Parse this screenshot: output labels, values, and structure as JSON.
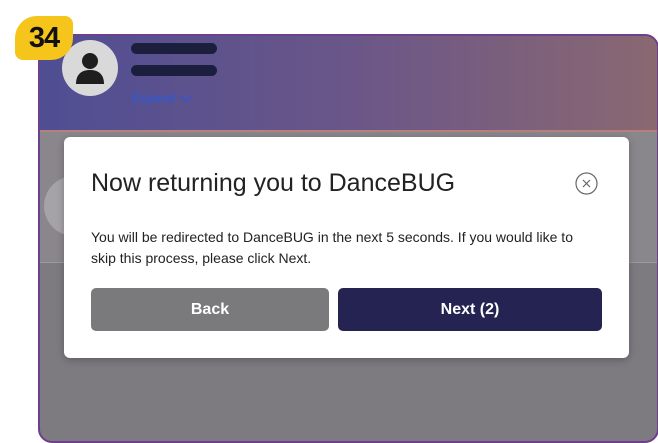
{
  "badge": {
    "number": "34"
  },
  "header": {
    "expand_label": "Expand"
  },
  "dialog": {
    "title": "Now returning you to DanceBUG",
    "message": "You will be redirected to DanceBUG in the next 5 seconds. If you would like to skip this process, please click Next.",
    "back_label": "Back",
    "next_label": "Next (2)"
  },
  "icons": {
    "avatar": "user-silhouette-icon",
    "expand": "chevron-down-icon",
    "close": "close-circle-icon"
  },
  "colors": {
    "badge": "#f5c51b",
    "frame_border": "#6e3f8c",
    "next_button": "#242351",
    "back_button": "#7a7a7c",
    "expand_link": "#3657c8"
  }
}
